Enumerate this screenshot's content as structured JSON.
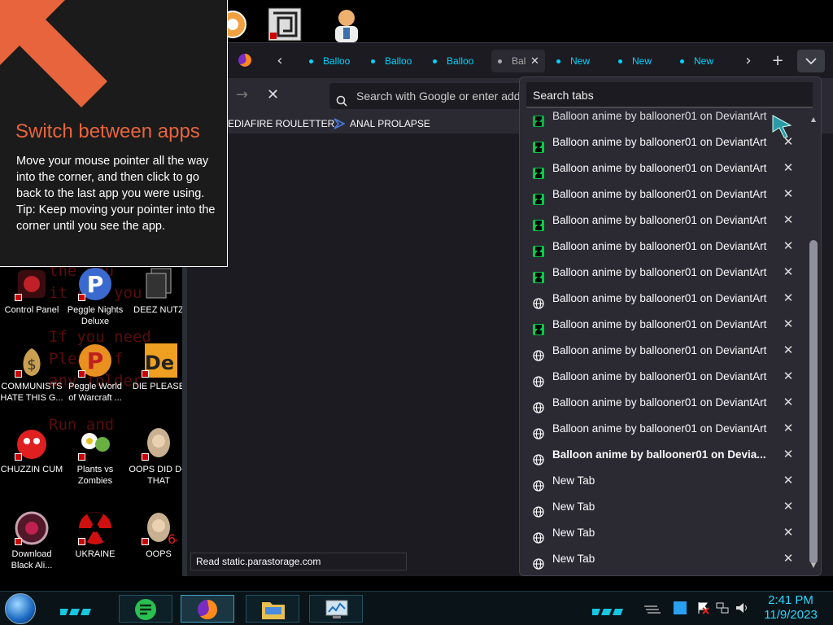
{
  "tip": {
    "title": "Switch between apps",
    "body": "Move your mouse pointer all the way into the corner, and then click to go back to the last app you were using.",
    "tip": "Tip: Keep moving your pointer into the corner until you see the app."
  },
  "background_text": "the you\nit com you\n\nIf you need\nPlease f\nany folder\n\nRun and",
  "desktop_icons": [
    {
      "label": "Control Panel"
    },
    {
      "label": "Peggle Nights Deluxe"
    },
    {
      "label": "DEEZ NUTZ"
    },
    {
      "label": "COMMUNISTS HATE THIS G..."
    },
    {
      "label": "Peggle World of Warcraft ..."
    },
    {
      "label": "DIE PLEASE"
    },
    {
      "label": "CHUZZIN CUM"
    },
    {
      "label": "Plants vs Zombies"
    },
    {
      "label": "OOPS DID DO THAT"
    },
    {
      "label": "Download Black Ali..."
    },
    {
      "label": "UKRAINE"
    },
    {
      "label": "OOPS"
    }
  ],
  "browser": {
    "tabs": [
      {
        "label": "Balloo"
      },
      {
        "label": "Balloo"
      },
      {
        "label": "Balloo"
      },
      {
        "label": "Bal"
      },
      {
        "label": "New"
      },
      {
        "label": "New"
      },
      {
        "label": "New"
      }
    ],
    "url_placeholder": "Search with Google or enter address",
    "bookmarks": [
      {
        "label": "MEDIAFIRE ROULETTER"
      },
      {
        "label": "ANAL PROLAPSE"
      }
    ],
    "status": "Read static.parastorage.com"
  },
  "tab_list": {
    "search_placeholder": "Search tabs",
    "partial_top": "Balloon anime by ballooner01 on DeviantArt",
    "items": [
      {
        "title": "Balloon anime by ballooner01 on DeviantArt",
        "icon": "deviantart-icon"
      },
      {
        "title": "Balloon anime by ballooner01 on DeviantArt",
        "icon": "deviantart-icon"
      },
      {
        "title": "Balloon anime by ballooner01 on DeviantArt",
        "icon": "deviantart-icon"
      },
      {
        "title": "Balloon anime by ballooner01 on DeviantArt",
        "icon": "deviantart-icon"
      },
      {
        "title": "Balloon anime by ballooner01 on DeviantArt",
        "icon": "deviantart-icon"
      },
      {
        "title": "Balloon anime by ballooner01 on DeviantArt",
        "icon": "deviantart-icon"
      },
      {
        "title": "Balloon anime by ballooner01 on DeviantArt",
        "icon": "globe-icon"
      },
      {
        "title": "Balloon anime by ballooner01 on DeviantArt",
        "icon": "deviantart-icon"
      },
      {
        "title": "Balloon anime by ballooner01 on DeviantArt",
        "icon": "globe-icon"
      },
      {
        "title": "Balloon anime by ballooner01 on DeviantArt",
        "icon": "globe-icon"
      },
      {
        "title": "Balloon anime by ballooner01 on DeviantArt",
        "icon": "globe-icon"
      },
      {
        "title": "Balloon anime by ballooner01 on DeviantArt",
        "icon": "globe-icon"
      },
      {
        "title": "Balloon anime by ballooner01 on Devia...",
        "icon": "globe-icon",
        "bold": true
      },
      {
        "title": "New Tab",
        "icon": "globe-icon"
      },
      {
        "title": "New Tab",
        "icon": "globe-icon"
      },
      {
        "title": "New Tab",
        "icon": "globe-icon"
      },
      {
        "title": "New Tab",
        "icon": "globe-icon"
      }
    ]
  },
  "taskbar": {
    "time": "2:41 PM",
    "date": "11/9/2023"
  },
  "colors": {
    "accent_cyan": "#00d4ff",
    "tip_title": "#e8643c",
    "clock": "#2bd6ff"
  }
}
